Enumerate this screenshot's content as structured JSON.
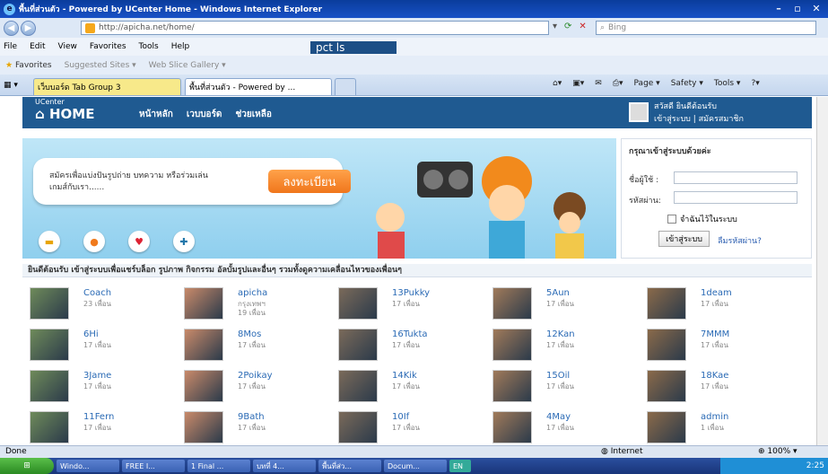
{
  "window": {
    "title": "พื้นที่ส่วนตัว - Powered by UCenter Home - Windows Internet Explorer"
  },
  "address": {
    "url": "http://apicha.net/home/",
    "search_placeholder": "Bing"
  },
  "menu": [
    "File",
    "Edit",
    "View",
    "Favorites",
    "Tools",
    "Help"
  ],
  "toolbar_brand": "pct  ls",
  "favbar": {
    "favorites": "Favorites",
    "suggested": "Suggested Sites ▾",
    "gallery": "Web Slice Gallery ▾"
  },
  "tabs": {
    "group": "เว็บบอร์ด Tab Group 3",
    "active": "พื้นที่ส่วนตัว - Powered by ..."
  },
  "commands": [
    "Page ▾",
    "Safety ▾",
    "Tools ▾"
  ],
  "site": {
    "logo_small": "UCenter",
    "logo_big": "HOME",
    "nav": [
      "หน้าหลัก",
      "เวบบอร์ด",
      "ช่วยเหลือ"
    ],
    "user_greeting": "สวัสดี ยินดีต้อนรับ",
    "user_links": "เข้าสู่ระบบ | สมัครสมาชิก"
  },
  "banner": {
    "text": "สมัครเพื่อแบ่งปันรูปถ่าย บทความ หรือร่วมเล่นเกมส์กับเรา......",
    "register_button": "ลงทะเบียน"
  },
  "login": {
    "heading": "กรุณาเข้าสู่ระบบด้วยค่ะ",
    "username_label": "ชื่อผู้ใช้ :",
    "password_label": "รหัสผ่าน:",
    "remember": "จำฉันไว้ในระบบ",
    "submit": "เข้าสู่ระบบ",
    "forgot": "ลืมรหัสผ่าน?"
  },
  "welcome": "ยินดีต้อนรับ เข้าสู่ระบบเพื่อแชร์บล็อก รูปภาพ กิจกรรม อัลบั้มรูปและอื่นๆ รวมทั้งดูความเคลื่อนไหวของเพื่อนๆ",
  "members": [
    {
      "name": "Coach",
      "sub": "23 เพื่อน"
    },
    {
      "name": "apicha",
      "sub": "กรุงเทพฯ\n19 เพื่อน"
    },
    {
      "name": "13Pukky",
      "sub": "17 เพื่อน"
    },
    {
      "name": "5Aun",
      "sub": "17 เพื่อน"
    },
    {
      "name": "1deam",
      "sub": "17 เพื่อน"
    },
    {
      "name": "6Hi",
      "sub": "17 เพื่อน"
    },
    {
      "name": "8Mos",
      "sub": "17 เพื่อน"
    },
    {
      "name": "16Tukta",
      "sub": "17 เพื่อน"
    },
    {
      "name": "12Kan",
      "sub": "17 เพื่อน"
    },
    {
      "name": "7MMM",
      "sub": "17 เพื่อน"
    },
    {
      "name": "3Jame",
      "sub": "17 เพื่อน"
    },
    {
      "name": "2Poikay",
      "sub": "17 เพื่อน"
    },
    {
      "name": "14Kik",
      "sub": "17 เพื่อน"
    },
    {
      "name": "15Oil",
      "sub": "17 เพื่อน"
    },
    {
      "name": "18Kae",
      "sub": "17 เพื่อน"
    },
    {
      "name": "11Fern",
      "sub": "17 เพื่อน"
    },
    {
      "name": "9Bath",
      "sub": "17 เพื่อน"
    },
    {
      "name": "10If",
      "sub": "17 เพื่อน"
    },
    {
      "name": "4May",
      "sub": "17 เพื่อน"
    },
    {
      "name": "admin",
      "sub": "1 เพื่อน"
    }
  ],
  "status": {
    "left": "Done",
    "zone": "Internet",
    "zoom": "100%"
  },
  "taskbar": {
    "items": [
      "Windo...",
      "FREE I...",
      "1 Final ...",
      "บทที่ 4...",
      "พื้นที่ส่ว...",
      "Docum..."
    ],
    "lang": "EN",
    "clock": "2:25"
  }
}
